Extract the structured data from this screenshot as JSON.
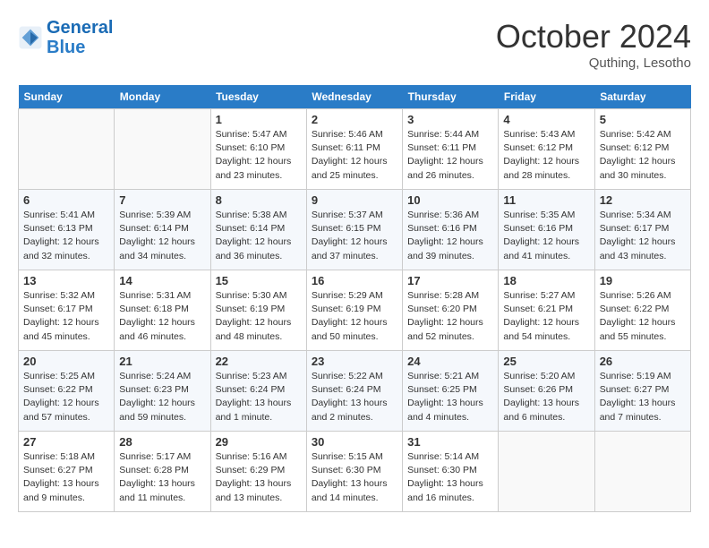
{
  "header": {
    "logo_general": "General",
    "logo_blue": "Blue",
    "month_title": "October 2024",
    "location": "Quthing, Lesotho"
  },
  "days_of_week": [
    "Sunday",
    "Monday",
    "Tuesday",
    "Wednesday",
    "Thursday",
    "Friday",
    "Saturday"
  ],
  "weeks": [
    [
      {
        "day": "",
        "info": ""
      },
      {
        "day": "",
        "info": ""
      },
      {
        "day": "1",
        "sunrise": "5:47 AM",
        "sunset": "6:10 PM",
        "daylight": "12 hours and 23 minutes."
      },
      {
        "day": "2",
        "sunrise": "5:46 AM",
        "sunset": "6:11 PM",
        "daylight": "12 hours and 25 minutes."
      },
      {
        "day": "3",
        "sunrise": "5:44 AM",
        "sunset": "6:11 PM",
        "daylight": "12 hours and 26 minutes."
      },
      {
        "day": "4",
        "sunrise": "5:43 AM",
        "sunset": "6:12 PM",
        "daylight": "12 hours and 28 minutes."
      },
      {
        "day": "5",
        "sunrise": "5:42 AM",
        "sunset": "6:12 PM",
        "daylight": "12 hours and 30 minutes."
      }
    ],
    [
      {
        "day": "6",
        "sunrise": "5:41 AM",
        "sunset": "6:13 PM",
        "daylight": "12 hours and 32 minutes."
      },
      {
        "day": "7",
        "sunrise": "5:39 AM",
        "sunset": "6:14 PM",
        "daylight": "12 hours and 34 minutes."
      },
      {
        "day": "8",
        "sunrise": "5:38 AM",
        "sunset": "6:14 PM",
        "daylight": "12 hours and 36 minutes."
      },
      {
        "day": "9",
        "sunrise": "5:37 AM",
        "sunset": "6:15 PM",
        "daylight": "12 hours and 37 minutes."
      },
      {
        "day": "10",
        "sunrise": "5:36 AM",
        "sunset": "6:16 PM",
        "daylight": "12 hours and 39 minutes."
      },
      {
        "day": "11",
        "sunrise": "5:35 AM",
        "sunset": "6:16 PM",
        "daylight": "12 hours and 41 minutes."
      },
      {
        "day": "12",
        "sunrise": "5:34 AM",
        "sunset": "6:17 PM",
        "daylight": "12 hours and 43 minutes."
      }
    ],
    [
      {
        "day": "13",
        "sunrise": "5:32 AM",
        "sunset": "6:17 PM",
        "daylight": "12 hours and 45 minutes."
      },
      {
        "day": "14",
        "sunrise": "5:31 AM",
        "sunset": "6:18 PM",
        "daylight": "12 hours and 46 minutes."
      },
      {
        "day": "15",
        "sunrise": "5:30 AM",
        "sunset": "6:19 PM",
        "daylight": "12 hours and 48 minutes."
      },
      {
        "day": "16",
        "sunrise": "5:29 AM",
        "sunset": "6:19 PM",
        "daylight": "12 hours and 50 minutes."
      },
      {
        "day": "17",
        "sunrise": "5:28 AM",
        "sunset": "6:20 PM",
        "daylight": "12 hours and 52 minutes."
      },
      {
        "day": "18",
        "sunrise": "5:27 AM",
        "sunset": "6:21 PM",
        "daylight": "12 hours and 54 minutes."
      },
      {
        "day": "19",
        "sunrise": "5:26 AM",
        "sunset": "6:22 PM",
        "daylight": "12 hours and 55 minutes."
      }
    ],
    [
      {
        "day": "20",
        "sunrise": "5:25 AM",
        "sunset": "6:22 PM",
        "daylight": "12 hours and 57 minutes."
      },
      {
        "day": "21",
        "sunrise": "5:24 AM",
        "sunset": "6:23 PM",
        "daylight": "12 hours and 59 minutes."
      },
      {
        "day": "22",
        "sunrise": "5:23 AM",
        "sunset": "6:24 PM",
        "daylight": "13 hours and 1 minute."
      },
      {
        "day": "23",
        "sunrise": "5:22 AM",
        "sunset": "6:24 PM",
        "daylight": "13 hours and 2 minutes."
      },
      {
        "day": "24",
        "sunrise": "5:21 AM",
        "sunset": "6:25 PM",
        "daylight": "13 hours and 4 minutes."
      },
      {
        "day": "25",
        "sunrise": "5:20 AM",
        "sunset": "6:26 PM",
        "daylight": "13 hours and 6 minutes."
      },
      {
        "day": "26",
        "sunrise": "5:19 AM",
        "sunset": "6:27 PM",
        "daylight": "13 hours and 7 minutes."
      }
    ],
    [
      {
        "day": "27",
        "sunrise": "5:18 AM",
        "sunset": "6:27 PM",
        "daylight": "13 hours and 9 minutes."
      },
      {
        "day": "28",
        "sunrise": "5:17 AM",
        "sunset": "6:28 PM",
        "daylight": "13 hours and 11 minutes."
      },
      {
        "day": "29",
        "sunrise": "5:16 AM",
        "sunset": "6:29 PM",
        "daylight": "13 hours and 13 minutes."
      },
      {
        "day": "30",
        "sunrise": "5:15 AM",
        "sunset": "6:30 PM",
        "daylight": "13 hours and 14 minutes."
      },
      {
        "day": "31",
        "sunrise": "5:14 AM",
        "sunset": "6:30 PM",
        "daylight": "13 hours and 16 minutes."
      },
      {
        "day": "",
        "info": ""
      },
      {
        "day": "",
        "info": ""
      }
    ]
  ]
}
